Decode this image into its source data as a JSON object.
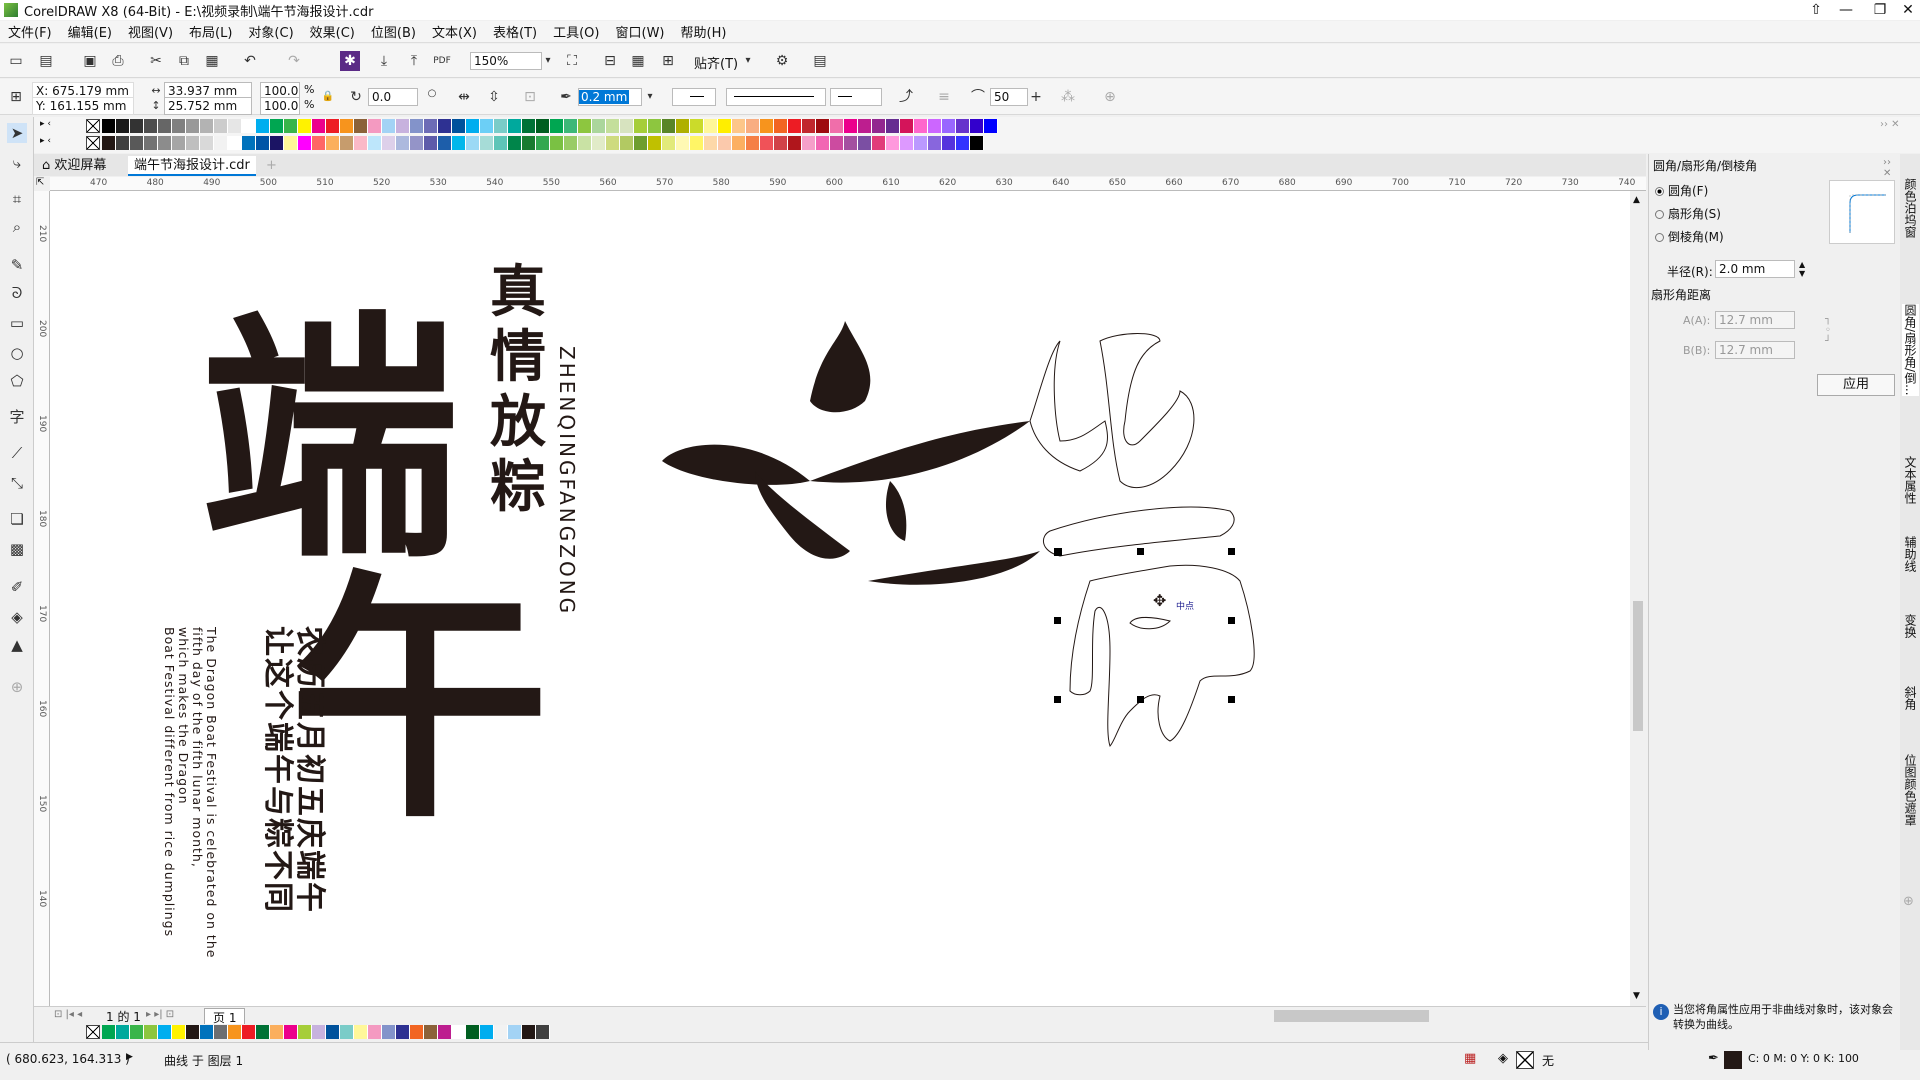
{
  "app": {
    "title": "CorelDRAW X8 (64-Bit) - E:\\视频录制\\端午节海报设计.cdr"
  },
  "menu": [
    "文件(F)",
    "编辑(E)",
    "视图(V)",
    "布局(L)",
    "对象(C)",
    "效果(C)",
    "位图(B)",
    "文本(X)",
    "表格(T)",
    "工具(O)",
    "窗口(W)",
    "帮助(H)"
  ],
  "toolbar": {
    "zoom": "150%",
    "snap_label": "贴齐(T)"
  },
  "propbar": {
    "x": "X: 675.179 mm",
    "y": "Y: 161.155 mm",
    "w": "33.937 mm",
    "h": "25.752 mm",
    "sx": "100.0",
    "sy": "100.0",
    "pct": "%",
    "angle": "0.0",
    "outline": "0.2 mm",
    "smooth": "50"
  },
  "tabs": {
    "welcome": "欢迎屏幕",
    "doc": "端午节海报设计.cdr"
  },
  "rulers": {
    "h": [
      "470",
      "480",
      "490",
      "500",
      "510",
      "520",
      "530",
      "540",
      "550",
      "560",
      "570",
      "580",
      "590",
      "600",
      "610",
      "620",
      "630",
      "640",
      "650",
      "660",
      "670",
      "680",
      "690",
      "700",
      "710",
      "720",
      "730",
      "740"
    ],
    "v": [
      "210",
      "200",
      "190",
      "180",
      "170",
      "160",
      "150",
      "140"
    ]
  },
  "artwork": {
    "big1": "端",
    "big2": "午",
    "vert_cn": [
      "真",
      "情",
      "放",
      "粽"
    ],
    "vert_en": "ZHENQINGFANGZONG",
    "body_cn1": "农历五月初五庆端午",
    "body_cn2": "让这个端午与粽不同",
    "body_en1": "The Dragon Boat Festival is celebrated on the",
    "body_en2": "fifth day of the fifth lunar month,",
    "body_en3": "which makes the Dragon",
    "body_en4": "Boat Festival different from rice dumplings",
    "midpoint": "中点"
  },
  "pager": {
    "count": "1 的 1",
    "page": "页 1"
  },
  "status": {
    "coords": "( 680.623, 164.313 )",
    "layer": "曲线 于 图层 1",
    "fill": "无",
    "cmyk": "C: 0 M: 0 Y: 0 K: 100"
  },
  "panel": {
    "title": "圆角/扇形角/倒棱角",
    "opt1": "圆角(F)",
    "opt2": "扇形角(S)",
    "opt3": "倒棱角(M)",
    "radius_label": "半径(R):",
    "radius": "2.0 mm",
    "dist_label": "扇形角距离",
    "a_label": "A(A):",
    "a_val": "12.7 mm",
    "b_label": "B(B):",
    "b_val": "12.7 mm",
    "apply": "应用",
    "hint": "当您将角属性应用于非曲线对象时，该对象会转换为曲线。"
  },
  "docker_tabs": [
    "颜色泊坞窗",
    "圆角/扇形角/倒...",
    "文本属性",
    "辅助线",
    "变换",
    "斜角",
    "位图颜色遮罩"
  ],
  "colors": {
    "palette_top": [
      "#000000",
      "#1a1a1a",
      "#333333",
      "#4d4d4d",
      "#666666",
      "#808080",
      "#999999",
      "#b3b3b3",
      "#cccccc",
      "#e6e6e6",
      "#ffffff",
      "#00aeef",
      "#00a651",
      "#39b54a",
      "#fff200",
      "#ec008c",
      "#ed1c24",
      "#f7941d",
      "#8c6239",
      "#f49ac1",
      "#a3d3f5",
      "#c7b2de",
      "#8393ca",
      "#6d6cb6",
      "#2e3192",
      "#00529c",
      "#00adef",
      "#6ccff6",
      "#7accc8",
      "#00a99d",
      "#007236",
      "#005e20",
      "#00a651",
      "#3cb878",
      "#8dc63f",
      "#abd69c",
      "#c4df9b",
      "#d7e3bf",
      "#a6ce39",
      "#8dc63f",
      "#598527",
      "#afb000",
      "#cbdb2a",
      "#fff799",
      "#ffee00",
      "#fdc689",
      "#f9ad81",
      "#f7941d",
      "#f26522",
      "#ed1c24",
      "#c1272d",
      "#9e0b0f",
      "#f06eaa",
      "#ec008c",
      "#bd1e8f",
      "#92278f",
      "#662d91",
      "#d4145a",
      "#ff66cc",
      "#cc66ff",
      "#9966ff",
      "#6633cc",
      "#3300cc",
      "#0000ff"
    ],
    "palette_bottom": [
      "#231815",
      "#404040",
      "#595959",
      "#737373",
      "#8c8c8c",
      "#a6a6a6",
      "#bfbfbf",
      "#d9d9d9",
      "#f2f2f2",
      "#ffffff",
      "#0072bc",
      "#0054a6",
      "#1b1464",
      "#fff799",
      "#ff00ff",
      "#ff6666",
      "#fbaf5d",
      "#c69c6d",
      "#fbb9c8",
      "#bde6fb",
      "#ddd0ea",
      "#acb9de",
      "#9494c8",
      "#5e5baa",
      "#1d5eaa",
      "#00b7eb",
      "#9bd9f5",
      "#a6dcd7",
      "#5ec5b8",
      "#00854a",
      "#197b30",
      "#33a850",
      "#7ac143",
      "#99cc66",
      "#c9e2a4",
      "#e1ebc8",
      "#cedb7e",
      "#b2c962",
      "#6e9e2e",
      "#c0c000",
      "#e2ea7a",
      "#fff9b3",
      "#fff566",
      "#fdd8a8",
      "#fbc9ac",
      "#fcaf61",
      "#f57f46",
      "#f05258",
      "#d14248",
      "#b0161c",
      "#f59fc9",
      "#f266b3",
      "#cc4ba0",
      "#a450a0",
      "#7b4fa3",
      "#e13b7a",
      "#ff99dd",
      "#dd99ff",
      "#bb99ff",
      "#8866dd",
      "#5533dd",
      "#3333ff",
      "#000000"
    ],
    "doc_palette": [
      "#00a651",
      "#00a99d",
      "#39b54a",
      "#8dc63f",
      "#00aeef",
      "#fff200",
      "#231815",
      "#0072bc",
      "#6d6e71",
      "#f7941d",
      "#ed1c24",
      "#007236",
      "#fbaf5d",
      "#ec008c",
      "#a6ce39",
      "#c7b2de",
      "#00529c",
      "#7accc8",
      "#fff799",
      "#f49ac1",
      "#8393ca",
      "#2e3192",
      "#f26522",
      "#8c6239",
      "#bd1e8f",
      "#ffffff",
      "#005e20",
      "#00adef",
      "#f2f2f2",
      "#a3d3f5",
      "#231815",
      "#404040"
    ],
    "ink": "#231815",
    "accent": "#0078d7"
  }
}
